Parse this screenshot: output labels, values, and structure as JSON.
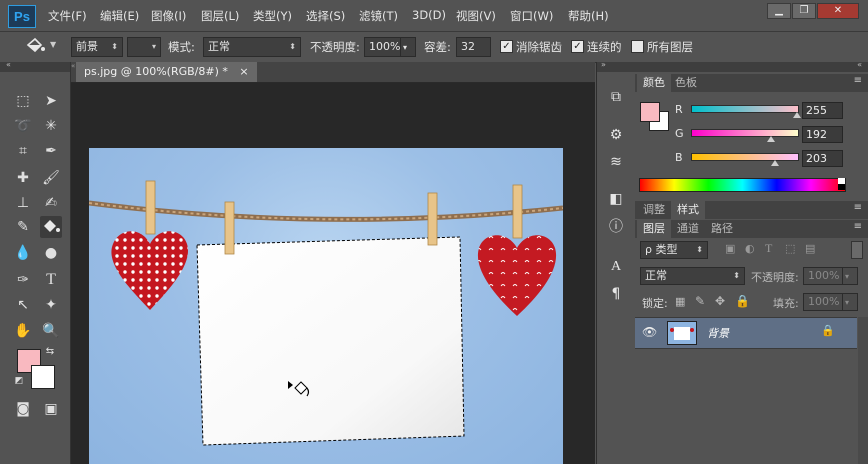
{
  "app": {
    "logo": "Ps"
  },
  "menu": [
    "文件(F)",
    "编辑(E)",
    "图像(I)",
    "图层(L)",
    "类型(Y)",
    "选择(S)",
    "滤镜(T)",
    "3D(D)",
    "视图(V)",
    "窗口(W)",
    "帮助(H)"
  ],
  "window_controls": {
    "minimize": "▁",
    "restore": "❐",
    "close": "✕"
  },
  "options": {
    "fill_source": "前景",
    "mode_label": "模式:",
    "mode_value": "正常",
    "opacity_label": "不透明度:",
    "opacity_value": "100%",
    "tolerance_label": "容差:",
    "tolerance_value": "32",
    "antialias_label": "消除锯齿",
    "antialias_checked": true,
    "contiguous_label": "连续的",
    "contiguous_checked": true,
    "all_layers_label": "所有图层",
    "all_layers_checked": false
  },
  "document": {
    "tab_title": "ps.jpg @ 100%(RGB/8#) *",
    "close": "×"
  },
  "color_panel": {
    "tabs": [
      "颜色",
      "色板"
    ],
    "foreground": "#f9b9c0",
    "background": "#ffffff",
    "channels": [
      {
        "label": "R",
        "value": "255",
        "fraction": 1.0
      },
      {
        "label": "G",
        "value": "192",
        "fraction": 0.753
      },
      {
        "label": "B",
        "value": "203",
        "fraction": 0.796
      }
    ]
  },
  "adjust_panel": {
    "tabs": [
      "调整",
      "样式"
    ]
  },
  "layers_panel": {
    "tabs": [
      "图层",
      "通道",
      "路径"
    ],
    "filter_kind": "ρ 类型",
    "blend_mode": "正常",
    "opacity_label": "不透明度:",
    "opacity_value": "100%",
    "lock_label": "锁定:",
    "fill_label": "填充:",
    "fill_value": "100%",
    "layer_name": "背景"
  },
  "toolbox": {
    "foreground": "#f9b9c0",
    "background": "#ffffff"
  }
}
